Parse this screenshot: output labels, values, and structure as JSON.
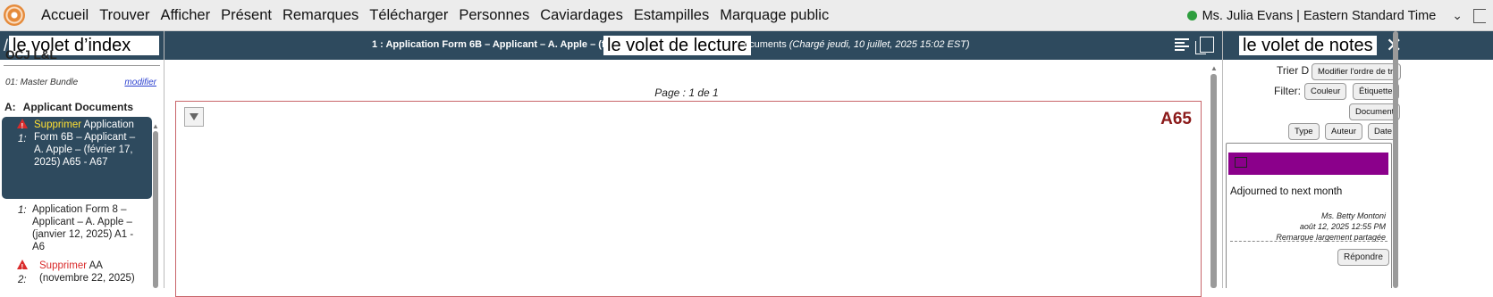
{
  "menu": {
    "items": [
      "Accueil",
      "Trouver",
      "Afficher",
      "Présent",
      "Remarques",
      "Télécharger",
      "Personnes",
      "Caviardages",
      "Estampilles",
      "Marquage public"
    ],
    "user": "Ms. Julia Evans | Eastern Standard Time"
  },
  "index_pane": {
    "overlay_label": "le volet d’index",
    "bundle_title": "OCJ L&L",
    "master_bundle": "01: Master Bundle",
    "modify_link": "modifier",
    "section": {
      "letter": "A:",
      "title": "Applicant Documents"
    },
    "documents": [
      {
        "num": "1:",
        "delete": "Supprimer",
        "title": "Application Form 6B – Applicant – A. Apple – (février 17, 2025) A65 - A67"
      },
      {
        "num": "1:",
        "delete": "",
        "title": "Application Form 8 – Applicant – A. Apple – (janvier 12, 2025) A1 - A6"
      },
      {
        "num": "2:",
        "delete": "Supprimer",
        "title": "AA (novembre 22, 2025)"
      }
    ]
  },
  "reading_pane": {
    "overlay_label": "le volet de lecture",
    "title": "1 : Application Form 6B – Applicant – A. Apple – (fé",
    "title_tail": "ocuments",
    "loaded": "(Chargé jeudi, 10 juillet, 2025 15:02 EST)",
    "page_count": "Page : 1 de 1",
    "stamp": "A65"
  },
  "notes_pane": {
    "overlay_label": "le volet de notes",
    "sort_label": "Trier D",
    "reorder_button": "Modifier l'ordre de tri",
    "filter_label": "Filter:",
    "filters": {
      "color": "Couleur",
      "label": "Étiquette",
      "document": "Document",
      "type": "Type",
      "author": "Auteur",
      "date": "Date"
    },
    "note": {
      "color": "#8b008b",
      "text": "Adjourned to next month",
      "author": "Ms. Betty Montoni",
      "date": "août 12, 2025 12:55 PM",
      "visibility": "Remarque largement partagée",
      "reply": "Répondre"
    }
  },
  "colors": {
    "header": "#2e4a5e",
    "accent_stamp": "#8b1a1a",
    "status_online": "#2e9e3e",
    "warning": "#d92b2b"
  }
}
